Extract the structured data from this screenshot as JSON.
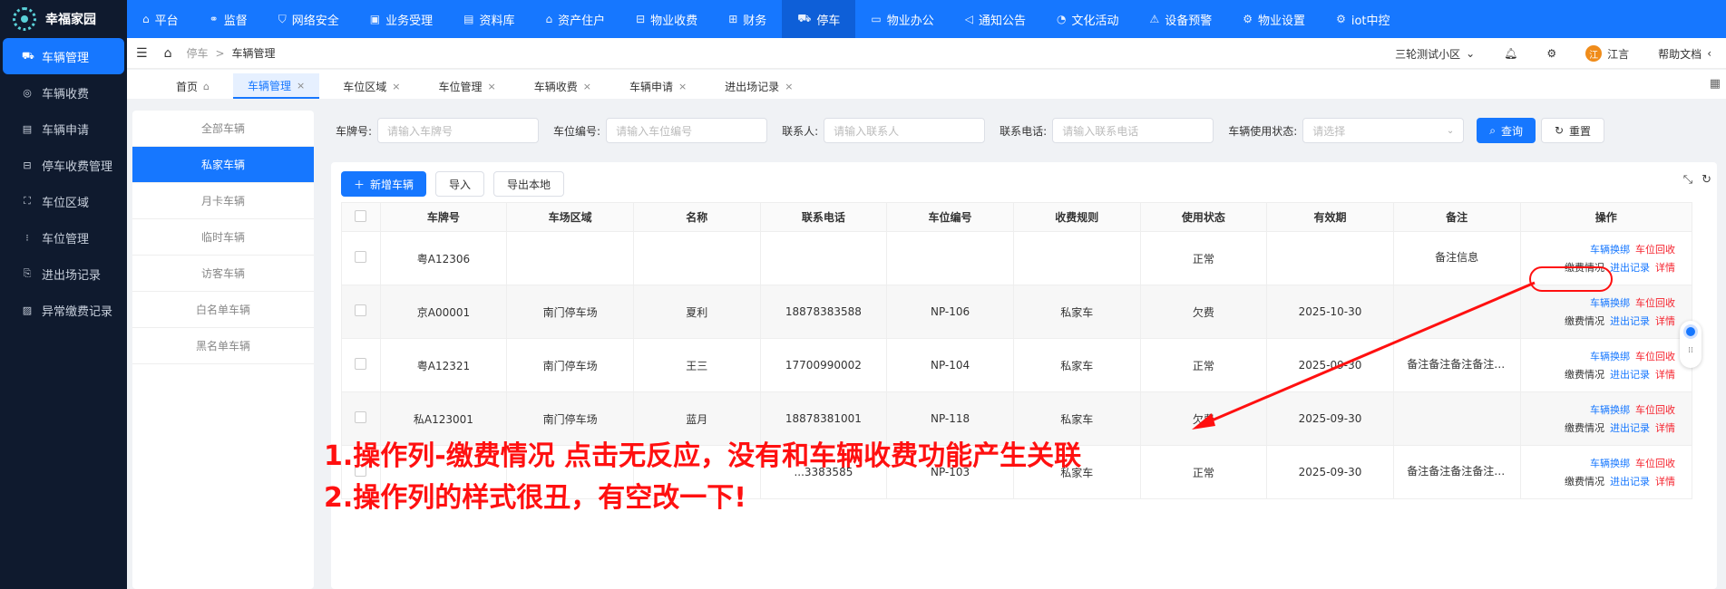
{
  "app": {
    "name": "幸福家园"
  },
  "topnav": [
    {
      "icon": "⌂",
      "label": "平台",
      "active": false
    },
    {
      "icon": "⚭",
      "label": "监督",
      "active": false
    },
    {
      "icon": "⛉",
      "label": "网络安全",
      "active": false
    },
    {
      "icon": "▣",
      "label": "业务受理",
      "active": false
    },
    {
      "icon": "▤",
      "label": "资料库",
      "active": false
    },
    {
      "icon": "⌂",
      "label": "资产住户",
      "active": false
    },
    {
      "icon": "⊟",
      "label": "物业收费",
      "active": false
    },
    {
      "icon": "⊞",
      "label": "财务",
      "active": false
    },
    {
      "icon": "⛟",
      "label": "停车",
      "active": true
    },
    {
      "icon": "▭",
      "label": "物业办公",
      "active": false
    },
    {
      "icon": "◁",
      "label": "通知公告",
      "active": false
    },
    {
      "icon": "◔",
      "label": "文化活动",
      "active": false
    },
    {
      "icon": "⚠",
      "label": "设备预警",
      "active": false
    },
    {
      "icon": "⚙",
      "label": "物业设置",
      "active": false
    },
    {
      "icon": "⚙",
      "label": "iot中控",
      "active": false
    }
  ],
  "sidebar": [
    {
      "icon": "⛟",
      "label": "车辆管理",
      "active": true
    },
    {
      "icon": "◎",
      "label": "车辆收费",
      "active": false
    },
    {
      "icon": "▤",
      "label": "车辆申请",
      "active": false
    },
    {
      "icon": "⊟",
      "label": "停车收费管理",
      "active": false
    },
    {
      "icon": "⛶",
      "label": "车位区域",
      "active": false
    },
    {
      "icon": "⁝",
      "label": "车位管理",
      "active": false
    },
    {
      "icon": "⎘",
      "label": "进出场记录",
      "active": false
    },
    {
      "icon": "▨",
      "label": "异常缴费记录",
      "active": false
    }
  ],
  "header": {
    "breadcrumb": [
      "停车",
      "车辆管理"
    ],
    "community": "三轮测试小区",
    "avatar_text": "江",
    "username": "江言",
    "help": "帮助文档"
  },
  "tabs": [
    {
      "label": "首页",
      "home": true,
      "active": false
    },
    {
      "label": "车辆管理",
      "active": true
    },
    {
      "label": "车位区域",
      "active": false
    },
    {
      "label": "车位管理",
      "active": false
    },
    {
      "label": "车辆收费",
      "active": false
    },
    {
      "label": "车辆申请",
      "active": false
    },
    {
      "label": "进出场记录",
      "active": false
    }
  ],
  "categories": [
    {
      "label": "全部车辆",
      "active": false
    },
    {
      "label": "私家车辆",
      "active": true
    },
    {
      "label": "月卡车辆",
      "active": false
    },
    {
      "label": "临时车辆",
      "active": false
    },
    {
      "label": "访客车辆",
      "active": false
    },
    {
      "label": "白名单车辆",
      "active": false
    },
    {
      "label": "黑名单车辆",
      "active": false
    }
  ],
  "search": {
    "plate_label": "车牌号:",
    "plate_placeholder": "请输入车牌号",
    "space_label": "车位编号:",
    "space_placeholder": "请输入车位编号",
    "contact_label": "联系人:",
    "contact_placeholder": "请输入联系人",
    "phone_label": "联系电话:",
    "phone_placeholder": "请输入联系电话",
    "status_label": "车辆使用状态:",
    "status_placeholder": "请选择",
    "query_label": "查询",
    "reset_label": "重置"
  },
  "toolbar": {
    "add_label": "新增车辆",
    "import_label": "导入",
    "export_label": "导出本地"
  },
  "table": {
    "headers": [
      "车牌号",
      "车场区域",
      "名称",
      "联系电话",
      "车位编号",
      "收费规则",
      "使用状态",
      "有效期",
      "备注",
      "操作"
    ],
    "rows": [
      {
        "plate": "粤A12306",
        "area": "",
        "name": "",
        "phone": "",
        "space": "",
        "rule": "",
        "status": "正常",
        "expiry": "",
        "remark": "备注信息"
      },
      {
        "plate": "京A00001",
        "area": "南门停车场",
        "name": "夏利",
        "phone": "18878383588",
        "space": "NP-106",
        "rule": "私家车",
        "status": "欠费",
        "expiry": "2025-10-30",
        "remark": ""
      },
      {
        "plate": "粤A12321",
        "area": "南门停车场",
        "name": "王三",
        "phone": "17700990002",
        "space": "NP-104",
        "rule": "私家车",
        "status": "正常",
        "expiry": "2025-09-30",
        "remark": "备注备注备注备注备..."
      },
      {
        "plate": "私A123001",
        "area": "南门停车场",
        "name": "蓝月",
        "phone": "18878381001",
        "space": "NP-118",
        "rule": "私家车",
        "status": "欠费",
        "expiry": "2025-09-30",
        "remark": ""
      },
      {
        "plate": "",
        "area": "",
        "name": "",
        "phone": "...3383585",
        "space": "NP-103",
        "rule": "私家车",
        "status": "正常",
        "expiry": "2025-09-30",
        "remark": "备注备注备注备注备注"
      }
    ],
    "ops": {
      "swap": "车辆换绑",
      "recycle": "车位回收",
      "payment": "缴费情况",
      "records": "进出记录",
      "detail": "详情"
    }
  },
  "annotation": {
    "line1": "1.操作列-缴费情况 点击无反应，没有和车辆收费功能产生关联",
    "line2": "2.操作列的样式很丑，有空改一下!",
    "color": "#ff1010"
  },
  "colors": {
    "primary": "#1677ff",
    "sidebar": "#0f1a2e",
    "danger": "#f5222d"
  }
}
